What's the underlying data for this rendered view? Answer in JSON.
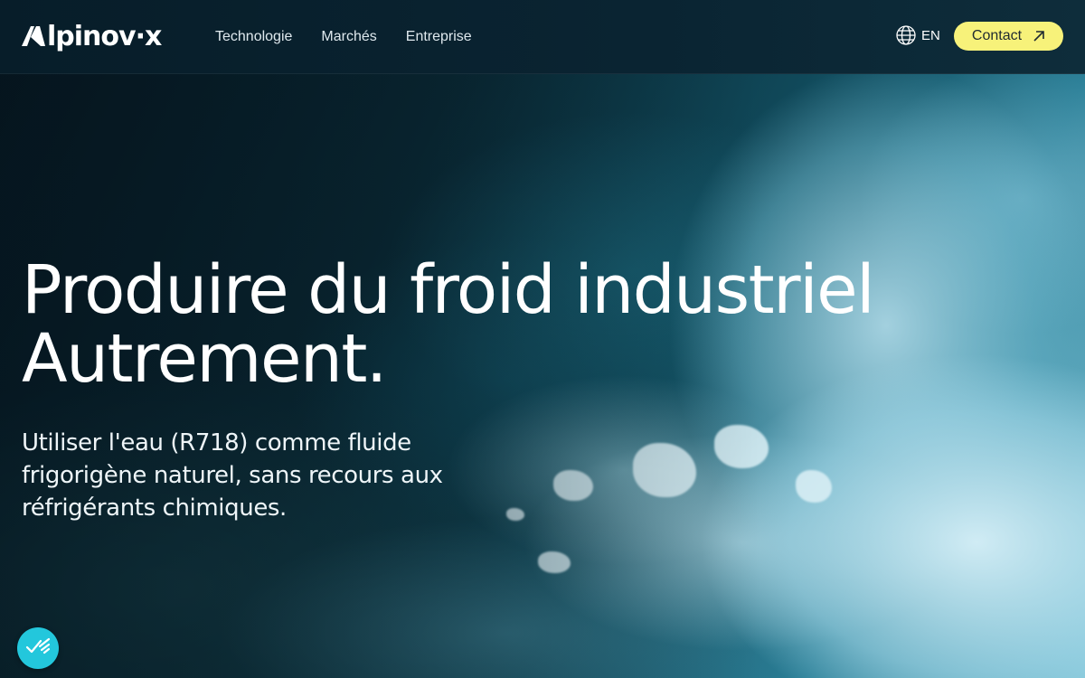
{
  "brand": {
    "logo_text": "lpinov·x",
    "logo_letter": "A"
  },
  "nav": {
    "links": [
      {
        "label": "Technologie"
      },
      {
        "label": "Marchés"
      },
      {
        "label": "Entreprise"
      }
    ],
    "language_label": "EN",
    "contact_label": "Contact"
  },
  "hero": {
    "title_line1": "Produire du froid industriel",
    "title_line2": "Autrement.",
    "subtitle": "Utiliser l'eau (R718) comme fluide frigorigène naturel, sans recours aux réfrigérants chimiques."
  },
  "icons": {
    "language": "globe-icon",
    "contact": "arrow-up-right-icon",
    "badge": "accessibility-checkmark-icon"
  },
  "colors": {
    "contact_button": "#f7f27a",
    "badge": "#23c7dc",
    "nav_background": "#0a2432"
  }
}
